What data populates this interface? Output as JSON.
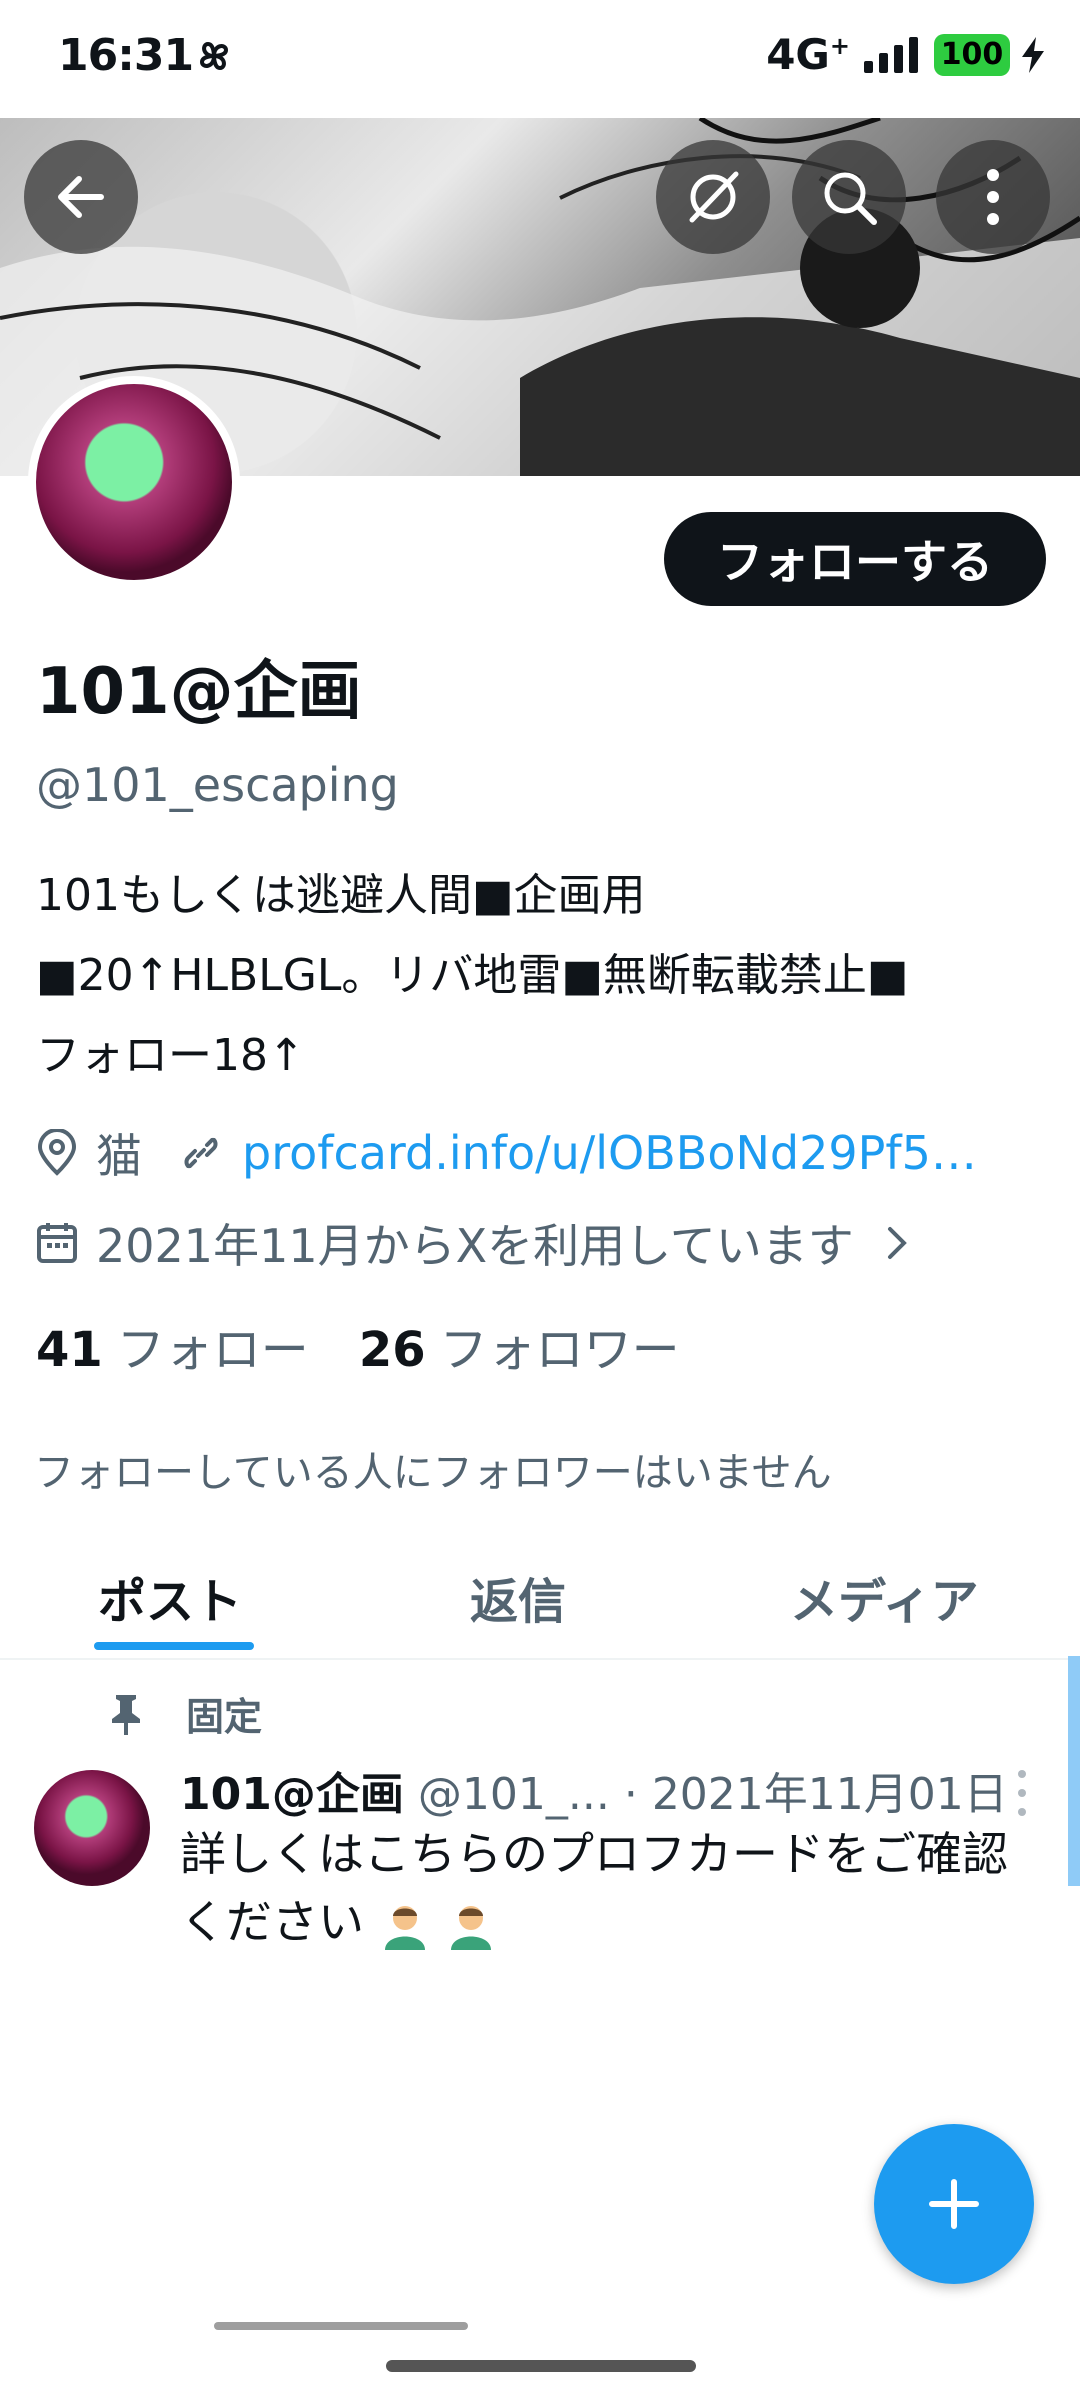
{
  "status_bar": {
    "time": "16:31",
    "network": "4G",
    "network_sup": "+",
    "battery": "100",
    "battery_color": "#2ecc40"
  },
  "header_buttons": {
    "back_icon": "arrow-left-icon",
    "grok_icon": "grok-icon",
    "search_icon": "search-icon",
    "more_icon": "more-vertical-icon"
  },
  "profile": {
    "follow_label": "フォローする",
    "display_name": "101@企画",
    "handle": "@101_escaping",
    "bio": "101もしくは逃避人間■企画用\n■20↑HLBLGL。リバ地雷■無断転載禁止■\nフォロー18↑",
    "location": "猫",
    "link": "profcard.info/u/lOBBoNd29Pf5…",
    "joined": "2021年11月からXを利用しています",
    "following_count": "41",
    "following_label": "フォロー",
    "followers_count": "26",
    "followers_label": "フォロワー",
    "followers_you_know": "フォローしている人にフォロワーはいません"
  },
  "tabs": [
    {
      "label": "ポスト",
      "active": true
    },
    {
      "label": "返信",
      "active": false
    },
    {
      "label": "メディア",
      "active": false
    }
  ],
  "pinned_post": {
    "pinned_label": "固定",
    "author_name": "101@企画",
    "author_handle": "@101_...",
    "separator": "·",
    "date": "2021年11月01日",
    "text": "詳しくはこちらのプロフカードをご確認ください"
  },
  "colors": {
    "accent": "#1d9bf0",
    "text_primary": "#0f1419",
    "text_secondary": "#536471"
  }
}
